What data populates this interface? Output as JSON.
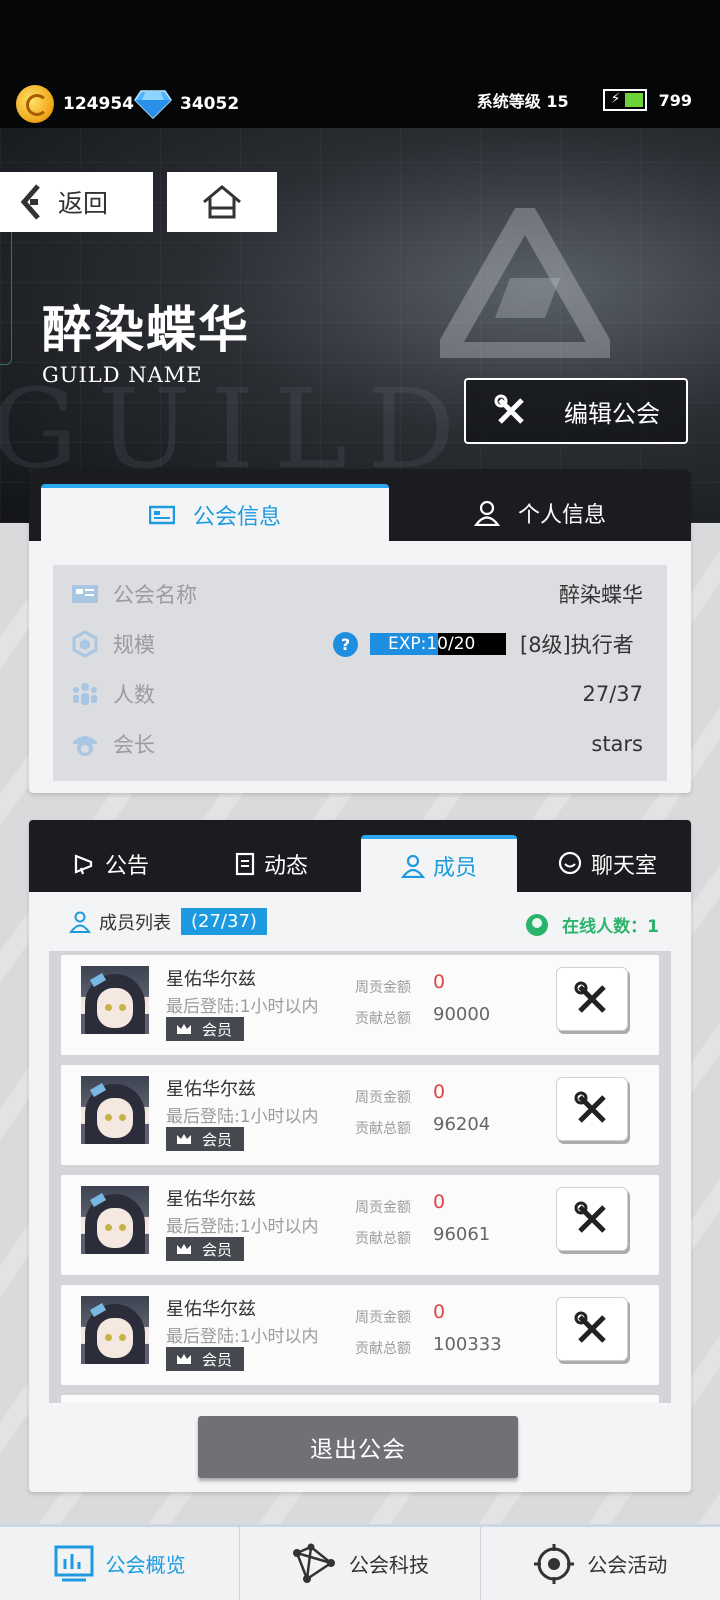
{
  "status": {
    "gold": "124954",
    "diamond": "34052",
    "system_level": "系统等级 15",
    "energy": "799"
  },
  "nav": {
    "back_label": "返回"
  },
  "guild": {
    "name": "醉染蝶华",
    "subtitle": "GUILD NAME",
    "edit_label": "编辑公会"
  },
  "info_tabs": [
    {
      "label": "公会信息",
      "active": true
    },
    {
      "label": "个人信息",
      "active": false
    }
  ],
  "info": {
    "name_label": "公会名称",
    "name_value": "醉染蝶华",
    "scale_label": "规模",
    "exp_text": "EXP:10/20",
    "exp_fraction": 0.5,
    "level_text": "[8级]执行者",
    "count_label": "人数",
    "count_value": "27/37",
    "leader_label": "会长",
    "leader_value": "stars"
  },
  "member_tabs": [
    {
      "label": "公告",
      "active": false
    },
    {
      "label": "动态",
      "active": false
    },
    {
      "label": "成员",
      "active": true
    },
    {
      "label": "聊天室",
      "active": false
    }
  ],
  "members_header": {
    "title": "成员列表",
    "count": "(27/37)",
    "online": "在线人数：1"
  },
  "member_labels": {
    "weekly": "周贡金额",
    "total": "贡献总额"
  },
  "members": [
    {
      "name": "星佑华尔兹",
      "last_login": "最后登陆:1小时以内",
      "role": "会员",
      "weekly": "0",
      "total": "90000"
    },
    {
      "name": "星佑华尔兹",
      "last_login": "最后登陆:1小时以内",
      "role": "会员",
      "weekly": "0",
      "total": "96204"
    },
    {
      "name": "星佑华尔兹",
      "last_login": "最后登陆:1小时以内",
      "role": "会员",
      "weekly": "0",
      "total": "96061"
    },
    {
      "name": "星佑华尔兹",
      "last_login": "最后登陆:1小时以内",
      "role": "会员",
      "weekly": "0",
      "total": "100333"
    }
  ],
  "quit_label": "退出公会",
  "bottom_nav": [
    {
      "label": "公会概览",
      "icon": "chart-icon",
      "active": true
    },
    {
      "label": "公会科技",
      "icon": "network-icon",
      "active": false
    },
    {
      "label": "公会活动",
      "icon": "target-icon",
      "active": false
    }
  ],
  "colors": {
    "accent": "#1e9be0",
    "online": "#2bb36b",
    "weekly_value": "#e04545"
  }
}
